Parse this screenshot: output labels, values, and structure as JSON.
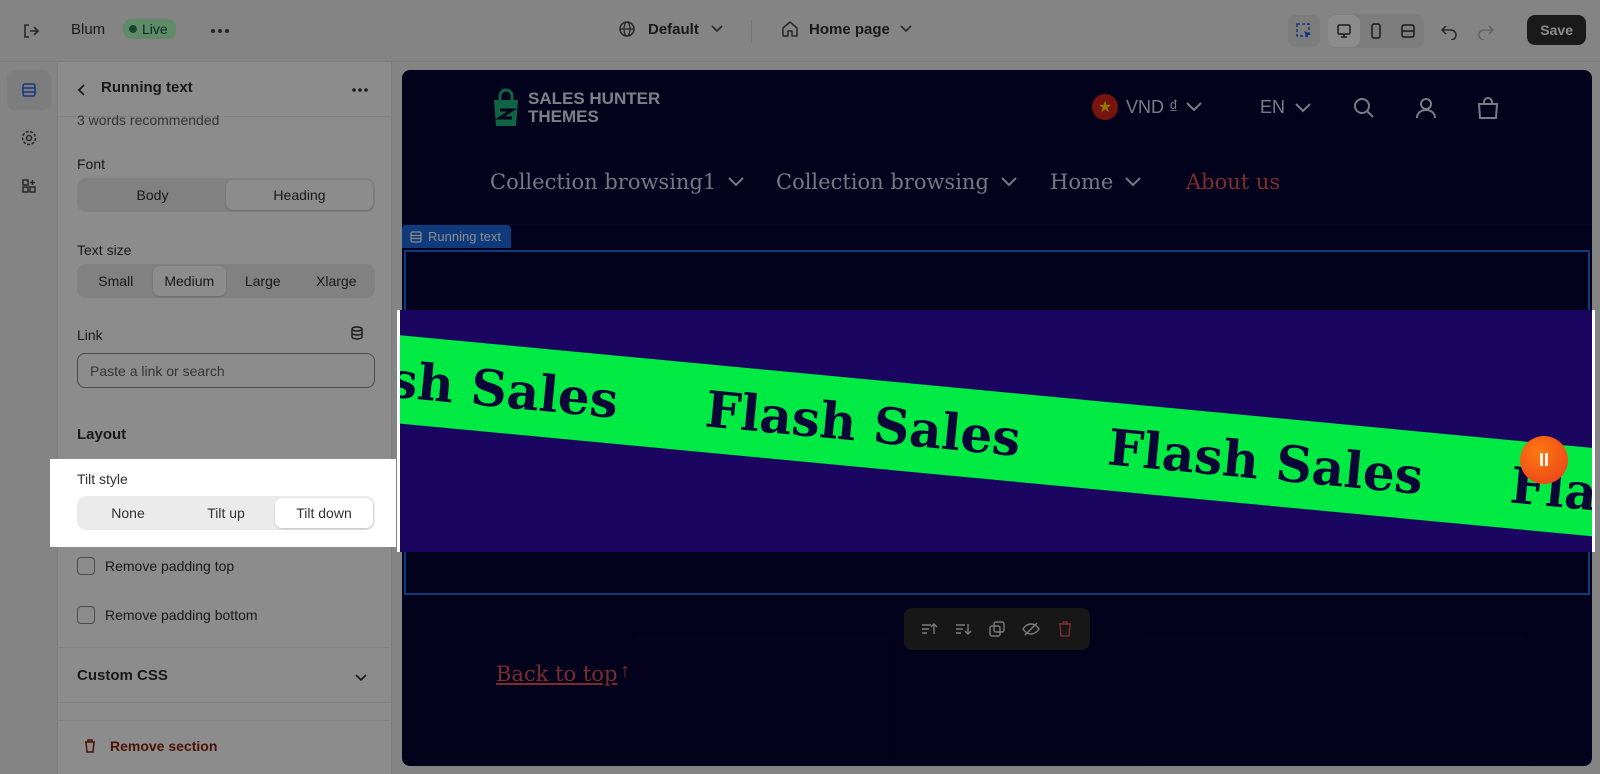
{
  "topbar": {
    "theme_name": "Blum",
    "status": "Live",
    "more_icon": "ellipsis-icon",
    "market": "Default",
    "page": "Home page",
    "save_label": "Save"
  },
  "panel": {
    "title": "Running text",
    "hint": "3 words recommended",
    "font_label": "Font",
    "font_options": [
      "Body",
      "Heading"
    ],
    "font_selected": "Heading",
    "size_label": "Text size",
    "size_options": [
      "Small",
      "Medium",
      "Large",
      "Xlarge"
    ],
    "size_selected": "Medium",
    "link_label": "Link",
    "link_placeholder": "Paste a link or search",
    "layout_title": "Layout",
    "tilt_label": "Tilt style",
    "tilt_options": [
      "None",
      "Tilt up",
      "Tilt down"
    ],
    "tilt_selected": "Tilt down",
    "pad_top": "Remove padding top",
    "pad_bottom": "Remove padding bottom",
    "custom_css": "Custom CSS",
    "remove_section": "Remove section"
  },
  "preview": {
    "logo_line1": "SALES HUNTER",
    "logo_line2": "THEMES",
    "currency": "VND ₫",
    "language": "EN",
    "nav": [
      "Collection browsing1",
      "Collection browsing",
      "Home",
      "About us"
    ],
    "section_tag": "Running text",
    "marquee_text": "Flash Sales",
    "back_to_top": "Back to top",
    "back_arrow": "↑",
    "pause_glyph": "II"
  },
  "colors": {
    "preview_bg": "#070433",
    "marquee_bg": "#1a0561",
    "band": "#00ea44",
    "accent_link": "#e25252",
    "selection": "#1d6be0"
  }
}
